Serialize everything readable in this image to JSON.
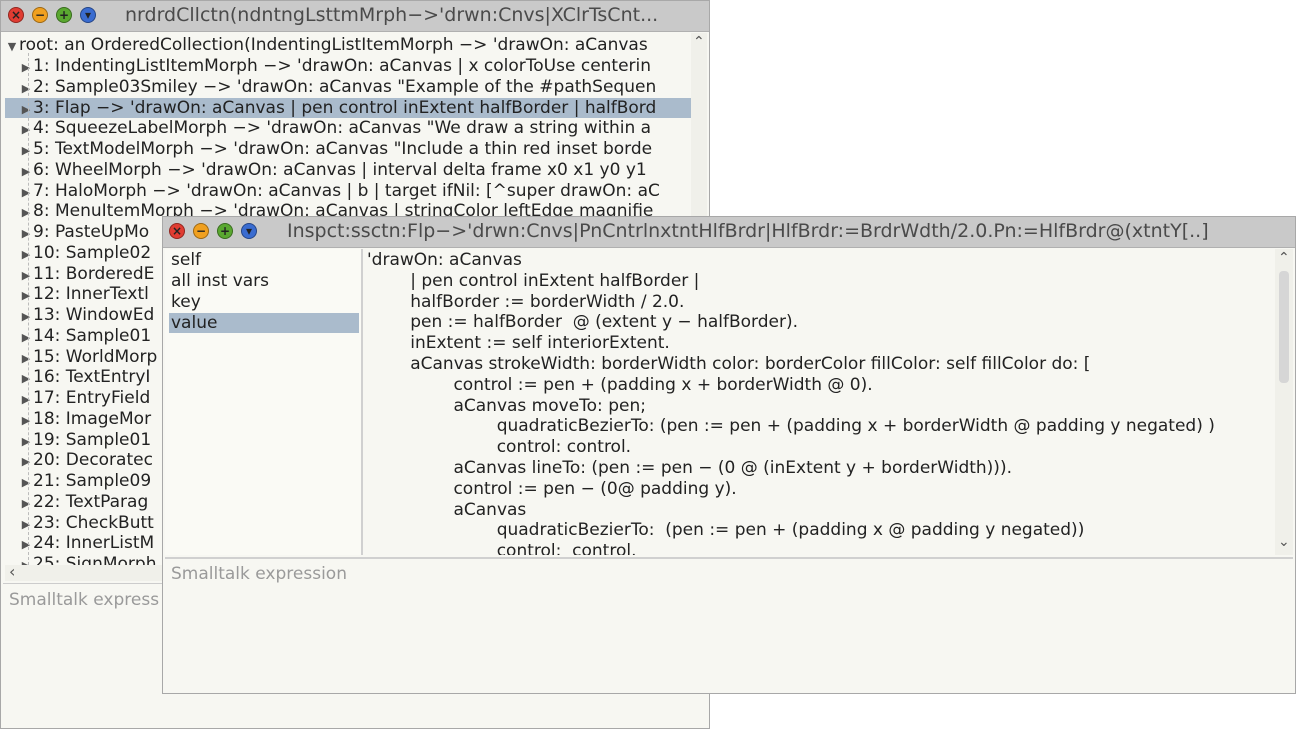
{
  "back_window": {
    "title": "nrdrdCllctn(ndntngLsttmMrph−>'drwn:Cnvs|XClrTsCnt...",
    "tree": {
      "root": "root: an OrderedCollection(IndentingListItemMorph −> 'drawOn: aCanvas",
      "items": [
        "1: IndentingListItemMorph −> 'drawOn: aCanvas | x colorToUse centerin",
        "2: Sample03Smiley −> 'drawOn: aCanvas \"Example of the #pathSequen",
        "3: Flap −> 'drawOn: aCanvas | pen control inExtent halfBorder | halfBord",
        "4: SqueezeLabelMorph −> 'drawOn: aCanvas \"We draw a string within a",
        "5: TextModelMorph −> 'drawOn: aCanvas \"Include a thin red inset borde",
        "6: WheelMorph −> 'drawOn: aCanvas | interval delta frame x0 x1 y0 y1",
        "7: HaloMorph −> 'drawOn: aCanvas | b | target ifNil: [^super drawOn: aC",
        "8: MenuItemMorph −> 'drawOn: aCanvas | stringColor leftEdge magnifie",
        "9: PasteUpMo",
        "10: Sample02",
        "11: BorderedE",
        "12: InnerTextl",
        "13: WindowEd",
        "14: Sample01",
        "15: WorldMorp",
        "16: TextEntryI",
        "17: EntryField",
        "18: ImageMor",
        "19: Sample01",
        "20: Decoratec",
        "21: Sample09",
        "22: TextParag",
        "23: CheckButt",
        "24: InnerListM",
        "25: SignMorph"
      ],
      "selected_index": 2
    },
    "eval_placeholder": "Smalltalk express"
  },
  "front_window": {
    "title": "Inspct:ssctn:Flp−>'drwn:Cnvs|PnCntrlnxtntHlfBrdr|HlfBrdr:=BrdrWdth/2.0.Pn:=HlfBrdr@(xtntY[..]",
    "fields": [
      "self",
      "all inst vars",
      "key",
      "value"
    ],
    "selected_field": 3,
    "code_lines": [
      "'drawOn: aCanvas",
      "        | pen control inExtent halfBorder |",
      "        halfBorder := borderWidth / 2.0.",
      "        pen := halfBorder  @ (extent y − halfBorder).",
      "        inExtent := self interiorExtent.",
      "        aCanvas strokeWidth: borderWidth color: borderColor fillColor: self fillColor do: [",
      "                control := pen + (padding x + borderWidth @ 0).",
      "                aCanvas moveTo: pen;",
      "                        quadraticBezierTo: (pen := pen + (padding x + borderWidth @ padding y negated) )",
      "                        control: control.",
      "                aCanvas lineTo: (pen := pen − (0 @ (inExtent y + borderWidth))).",
      "                control := pen − (0@ padding y).",
      "                aCanvas",
      "                        quadraticBezierTo:  (pen := pen + (padding x @ padding y negated))",
      "                        control:  control."
    ],
    "eval_placeholder": "Smalltalk expression"
  },
  "icons": {
    "close": "×",
    "minimize": "−",
    "maximize": "+",
    "menu": "▾",
    "expanded": "▼",
    "collapsed": "▶",
    "up": "⌃",
    "down": "⌄",
    "left": "‹"
  },
  "colors": {
    "close": "#e03c32",
    "minimize": "#f0a020",
    "maximize": "#5aa830",
    "menu": "#3a6cd0",
    "selection": "#aabbcc",
    "titlebar": "#c9c9c9"
  }
}
